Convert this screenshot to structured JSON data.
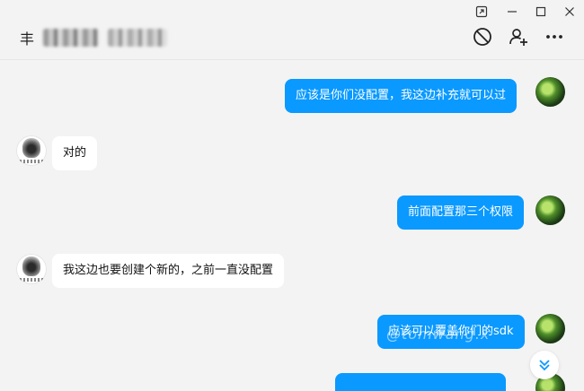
{
  "window": {
    "pin_icon": "pin-window-icon",
    "minimize_icon": "minimize-icon",
    "maximize_icon": "maximize-icon",
    "close_icon": "close-icon"
  },
  "header": {
    "title_lead": "丰",
    "block_icon": "block-icon",
    "add_user_icon": "add-user-icon",
    "more_icon": "more-icon"
  },
  "messages": [
    {
      "side": "out",
      "text": "应该是你们没配置，我这边补充就可以过"
    },
    {
      "side": "in",
      "text": "对的"
    },
    {
      "side": "out",
      "text": "前面配置那三个权限"
    },
    {
      "side": "in",
      "text": "我这边也要创建个新的，之前一直没配置"
    },
    {
      "side": "out",
      "text": "应该可以覆盖你们的sdk"
    },
    {
      "side": "out",
      "text": ""
    }
  ],
  "watermark": "@tomwang.x",
  "colors": {
    "outgoing_bubble": "#0a99ff",
    "incoming_bubble": "#ffffff",
    "background": "#f3f3f3"
  }
}
